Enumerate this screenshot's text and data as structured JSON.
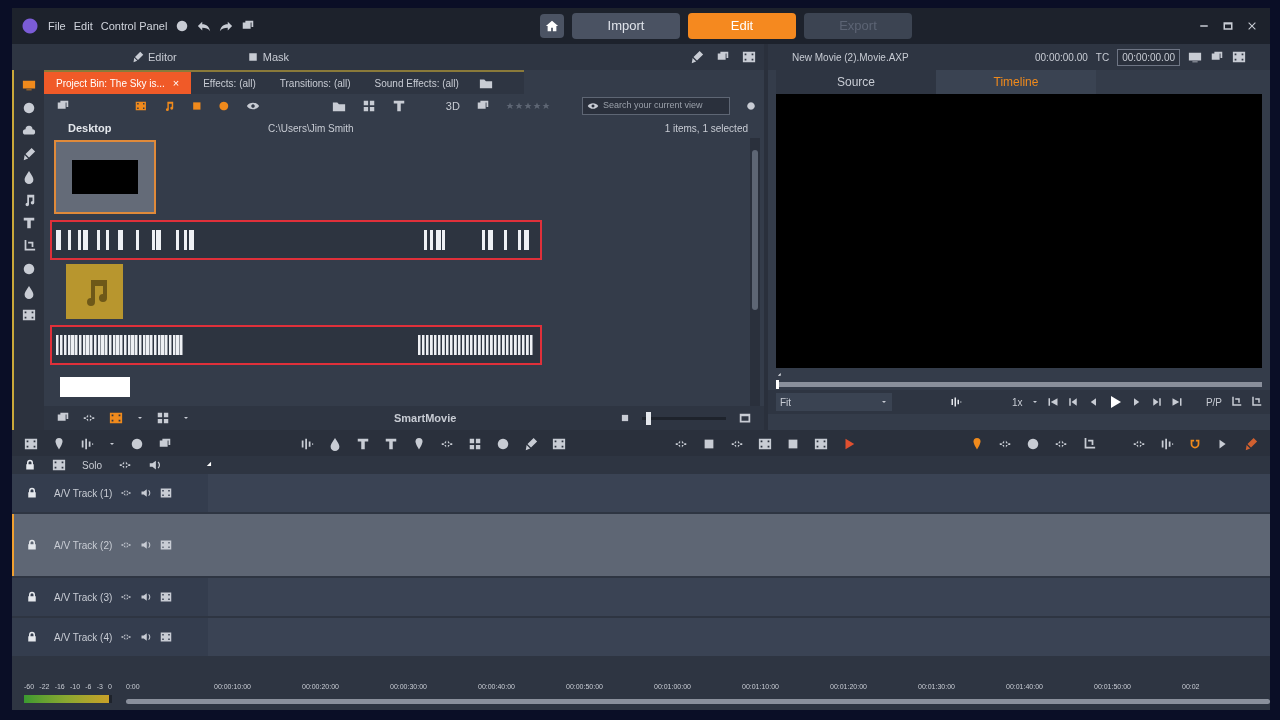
{
  "menu": [
    "File",
    "Edit",
    "Control Panel"
  ],
  "modes": [
    {
      "label": "Import",
      "selected": false,
      "disabled": false
    },
    {
      "label": "Edit",
      "selected": true,
      "disabled": false
    },
    {
      "label": "Export",
      "selected": false,
      "disabled": true
    }
  ],
  "library": {
    "header_tabs": [
      "Editor",
      "Mask"
    ],
    "tabs": [
      {
        "label": "Project Bin: The Sky is...",
        "selected": true,
        "close": "×"
      },
      {
        "label": "Effects: (all)",
        "selected": false
      },
      {
        "label": "Transitions: (all)",
        "selected": false
      },
      {
        "label": "Sound Effects: (all)",
        "selected": false
      }
    ],
    "view_3d": "3D",
    "search": {
      "placeholder": "Search your current view"
    },
    "folder": "Desktop",
    "path": "C:\\Users\\Jim Smith",
    "count": "1 items, 1 selected",
    "items": [
      {
        "kind": "video",
        "selected": true
      },
      {
        "kind": "waveform",
        "highlighted": true
      },
      {
        "kind": "audio",
        "selected": false
      },
      {
        "kind": "waveform",
        "highlighted": true
      },
      {
        "kind": "image",
        "selected": false
      }
    ],
    "footer": "SmartMovie",
    "zoom": {
      "level": 0.05
    }
  },
  "preview": {
    "title": "New Movie (2).Movie.AXP",
    "duration": "00:00:00.00",
    "tc_label": "TC",
    "tc_value": "00:00:00.00",
    "tabs": [
      {
        "label": "Source",
        "selected": false
      },
      {
        "label": "Timeline",
        "selected": true
      }
    ],
    "scrubber": {
      "level": 0
    },
    "fit": "Fit",
    "speed": "1x",
    "pip": "P/P"
  },
  "timeline": {
    "solo": "Solo",
    "tracks": [
      {
        "name": "A/V Track (1)",
        "selected": false
      },
      {
        "name": "A/V Track (2)",
        "selected": true
      },
      {
        "name": "A/V Track (3)",
        "selected": false
      },
      {
        "name": "A/V Track (4)",
        "selected": false
      }
    ],
    "meter_labels": [
      "-60",
      "-22",
      "-16",
      "-10",
      "-6",
      "-3",
      "0"
    ],
    "meter": {
      "level": 0.97
    },
    "ruler": [
      "0:00",
      "00:00:10:00",
      "00:00:20:00",
      "00:00:30:00",
      "00:00:40:00",
      "00:00:50:00",
      "00:01:00:00",
      "00:01:10:00",
      "00:01:20:00",
      "00:01:30:00",
      "00:01:40:00",
      "00:01:50:00",
      "00:02"
    ]
  }
}
